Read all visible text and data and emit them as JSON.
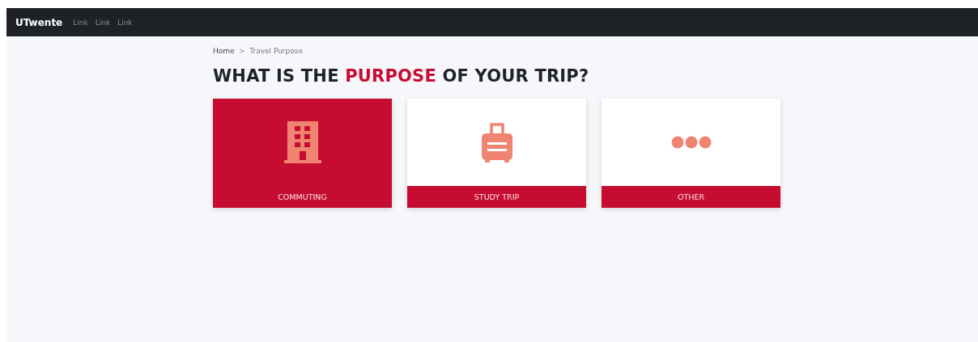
{
  "navbar": {
    "brand": "UTwente",
    "links": [
      "Link",
      "Link",
      "Link"
    ]
  },
  "breadcrumb": {
    "items": [
      "Home",
      "Travel Purpose"
    ],
    "separator": ">"
  },
  "title": {
    "before": "WHAT IS THE ",
    "highlight": "PURPOSE",
    "after": " OF YOUR TRIP?"
  },
  "options": [
    {
      "label": "COMMUTING",
      "kind": "building",
      "selected": true
    },
    {
      "label": "STUDY TRIP",
      "kind": "suitcase",
      "selected": false
    },
    {
      "label": "OTHER",
      "kind": "dots",
      "selected": false
    }
  ]
}
